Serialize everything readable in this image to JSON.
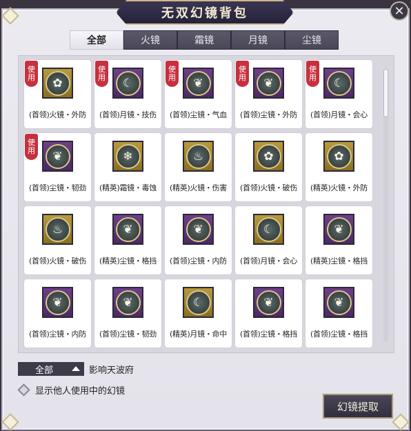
{
  "window": {
    "title": "无双幻镜背包",
    "close_glyph": "✕"
  },
  "tabs": [
    {
      "label": "全部",
      "active": true
    },
    {
      "label": "火镜",
      "active": false
    },
    {
      "label": "霜镜",
      "active": false
    },
    {
      "label": "月镜",
      "active": false
    },
    {
      "label": "尘镜",
      "active": false
    }
  ],
  "items": [
    {
      "label": "(首领)火镜・外防",
      "badge": "使用",
      "frame": "gold",
      "icon": "lotus-flame-icon",
      "glyph": "✿"
    },
    {
      "label": "(首领)月镜・技伤",
      "badge": "使用",
      "frame": "purple",
      "icon": "crescent-moon-icon",
      "glyph": "☾"
    },
    {
      "label": "(首领)尘镜・气血",
      "badge": "使用",
      "frame": "purple",
      "icon": "dust-swirl-icon",
      "glyph": "❦"
    },
    {
      "label": "(首领)尘镜・外防",
      "badge": "使用",
      "frame": "purple",
      "icon": "dust-swirl-icon",
      "glyph": "❦"
    },
    {
      "label": "(首领)月镜・会心",
      "badge": "使用",
      "frame": "purple",
      "icon": "crescent-moon-icon",
      "glyph": "☾"
    },
    {
      "label": "(首领)尘镜・韧劲",
      "badge": "使用",
      "frame": "purple",
      "icon": "dust-swirl-icon",
      "glyph": "❦"
    },
    {
      "label": "(精英)霜镜・毒蚀",
      "badge": "",
      "frame": "gold",
      "icon": "frost-snowflake-icon",
      "glyph": "❄"
    },
    {
      "label": "(精英)火镜・伤害",
      "badge": "",
      "frame": "gold",
      "icon": "flame-icon",
      "glyph": "♨"
    },
    {
      "label": "(首领)火镜・破伤",
      "badge": "",
      "frame": "gold",
      "icon": "lotus-flame-icon",
      "glyph": "✿"
    },
    {
      "label": "(精英)火镜・外防",
      "badge": "",
      "frame": "gold",
      "icon": "lotus-flame-icon",
      "glyph": "✿"
    },
    {
      "label": "(首领)火镜・破伤",
      "badge": "",
      "frame": "gold",
      "icon": "flame-icon",
      "glyph": "♨"
    },
    {
      "label": "(精英)尘镜・格挡",
      "badge": "",
      "frame": "purple",
      "icon": "dust-swirl-icon",
      "glyph": "❦"
    },
    {
      "label": "(首领)尘镜・内防",
      "badge": "",
      "frame": "purple",
      "icon": "dust-swirl-icon",
      "glyph": "❦"
    },
    {
      "label": "(首领)月镜・会心",
      "badge": "",
      "frame": "gold",
      "icon": "crescent-moon-icon",
      "glyph": "☾"
    },
    {
      "label": "(精英)尘镜・格挡",
      "badge": "",
      "frame": "purple",
      "icon": "dust-swirl-icon",
      "glyph": "❦"
    },
    {
      "label": "(首领)尘镜・内防",
      "badge": "",
      "frame": "purple",
      "icon": "dust-swirl-icon",
      "glyph": "❦"
    },
    {
      "label": "(首领)尘镜・韧劲",
      "badge": "",
      "frame": "purple",
      "icon": "dust-swirl-icon",
      "glyph": "❦"
    },
    {
      "label": "(精英)月镜・命中",
      "badge": "",
      "frame": "gold",
      "icon": "crescent-moon-icon",
      "glyph": "☾"
    },
    {
      "label": "(首领)尘镜・格挡",
      "badge": "",
      "frame": "purple",
      "icon": "dust-swirl-icon",
      "glyph": "❦"
    },
    {
      "label": "(首领)尘镜・格挡",
      "badge": "",
      "frame": "purple",
      "icon": "dust-swirl-icon",
      "glyph": "❦"
    }
  ],
  "filter": {
    "selected": "全部",
    "description": "影响天波府"
  },
  "show_others": {
    "label": "显示他人使用中的幻镜",
    "checked": false
  },
  "extract_button": {
    "label": "幻镜提取"
  },
  "colors": {
    "badge": "#c7303f",
    "gold_frame": "#b89a3e",
    "purple_frame": "#6e3f8a"
  }
}
